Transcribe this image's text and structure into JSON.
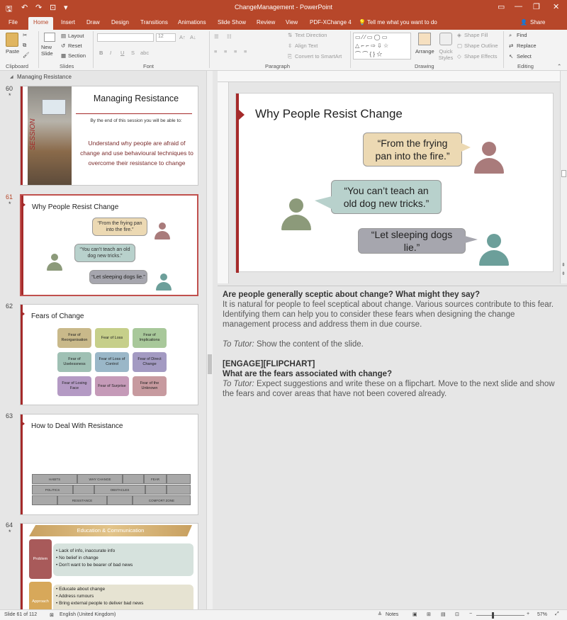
{
  "app": {
    "title": "ChangeManagement - PowerPoint"
  },
  "quick_access": {
    "save": "🖫",
    "undo": "↶",
    "redo": "↷",
    "present": "⊡",
    "more": "▾"
  },
  "window_controls": {
    "ribbon": "▭",
    "minimize": "—",
    "restore": "❐",
    "close": "✕"
  },
  "tabs": {
    "file": "File",
    "home": "Home",
    "insert": "Insert",
    "draw": "Draw",
    "design": "Design",
    "transitions": "Transitions",
    "animations": "Animations",
    "slideshow": "Slide Show",
    "review": "Review",
    "view": "View",
    "pdfx": "PDF-XChange 4",
    "tellme": "Tell me what you want to do",
    "share": "Share"
  },
  "ribbon": {
    "paste": "Paste",
    "new_slide": "New Slide",
    "layout": "Layout",
    "reset": "Reset",
    "section": "Section",
    "text_direction": "Text Direction",
    "align_text": "Align Text",
    "convert_smartart": "Convert to SmartArt",
    "arrange": "Arrange",
    "quick_styles": "Quick Styles",
    "shape_fill": "Shape Fill",
    "shape_outline": "Shape Outline",
    "shape_effects": "Shape Effects",
    "find": "Find",
    "replace": "Replace",
    "select": "Select",
    "font_size": "12",
    "bold": "B",
    "italic": "I",
    "underline": "U",
    "strike": "S",
    "shadow": "abc",
    "groups": {
      "clipboard": "Clipboard",
      "slides": "Slides",
      "font": "Font",
      "paragraph": "Paragraph",
      "drawing": "Drawing",
      "editing": "Editing"
    }
  },
  "sidebar": {
    "section": "Managing Resistance"
  },
  "thumbnails": {
    "s60": {
      "num": "60",
      "title": "Managing Resistance",
      "session": "SESSION",
      "intro": "By the end of this session you will be able to:",
      "body": "Understand why people are afraid of change and use behavioural techniques to overcome their resistance to change"
    },
    "s61": {
      "num": "61",
      "title": "Why People Resist Change",
      "q1": "“From the frying pan into the fire.”",
      "q2": "“You can’t teach an old dog new tricks.”",
      "q3": "“Let sleeping dogs lie.”"
    },
    "s62": {
      "num": "62",
      "title": "Fears of Change",
      "boxes": [
        "Fear of Reorganisation",
        "Fear of Loss",
        "Fear of Implications",
        "Fear of Uselessness",
        "Fear of Loss of Control",
        "Fear of Direct Change",
        "Fear of Losing Face",
        "Fear of Surprise",
        "Fear of the Unknown"
      ]
    },
    "s63": {
      "num": "63",
      "title": "How to Deal With Resistance",
      "bricks": [
        "HABITS",
        "WHY CHANGE",
        "FEAR",
        "POLITICS",
        "OBSTACLES",
        "RESISTANCE",
        "COMFORT ZONE"
      ]
    },
    "s64": {
      "num": "64",
      "banner": "Education & Communication",
      "problem": "Problem",
      "approach": "Approach",
      "p1": "• Lack of info, inaccurate info",
      "p2": "• No belief in change",
      "p3": "• Don't want to be bearer of bad news",
      "a1": "• Educate about change",
      "a2": "• Address rumours",
      "a3": "• Bring external people to deliver bad news"
    }
  },
  "colors": {
    "accent": "#b7472a",
    "slide_red": "#a52a2a",
    "bubble_yellow": "#ecd9b3",
    "bubble_teal": "#b8d1cc",
    "bubble_gray": "#a6a6ae",
    "person_rose": "#a97b7b",
    "person_green": "#8c9a7a",
    "person_teal": "#6c9f9a"
  },
  "slide": {
    "title": "Why People Resist Change",
    "q1": "“From the frying pan into the fire.”",
    "q2": "“You can’t teach an old dog new tricks.”",
    "q3": "“Let sleeping dogs lie.”"
  },
  "notes": {
    "l1": "Are people generally sceptic about change? What might they say?",
    "l2": "It is natural for people to feel sceptical about change. Various sources contribute to this fear. Identifying them can help you to consider these fears when designing the change management process and address them in due course.",
    "l3_label": "To Tutor:",
    "l3": " Show the content of the slide.",
    "l4": "[ENGAGE][FLIPCHART]",
    "l5": "What are the fears associated with change?",
    "l6_label": "To Tutor:",
    "l6": " Expect suggestions and write these on a flipchart. Move to the next slide and show the fears and cover areas that have not been covered already."
  },
  "status": {
    "slide": "Slide 61 of 112",
    "lang": "English (United Kingdom)",
    "notes_btn": "Notes",
    "zoom": "57%",
    "minus": "−",
    "plus": "+"
  }
}
